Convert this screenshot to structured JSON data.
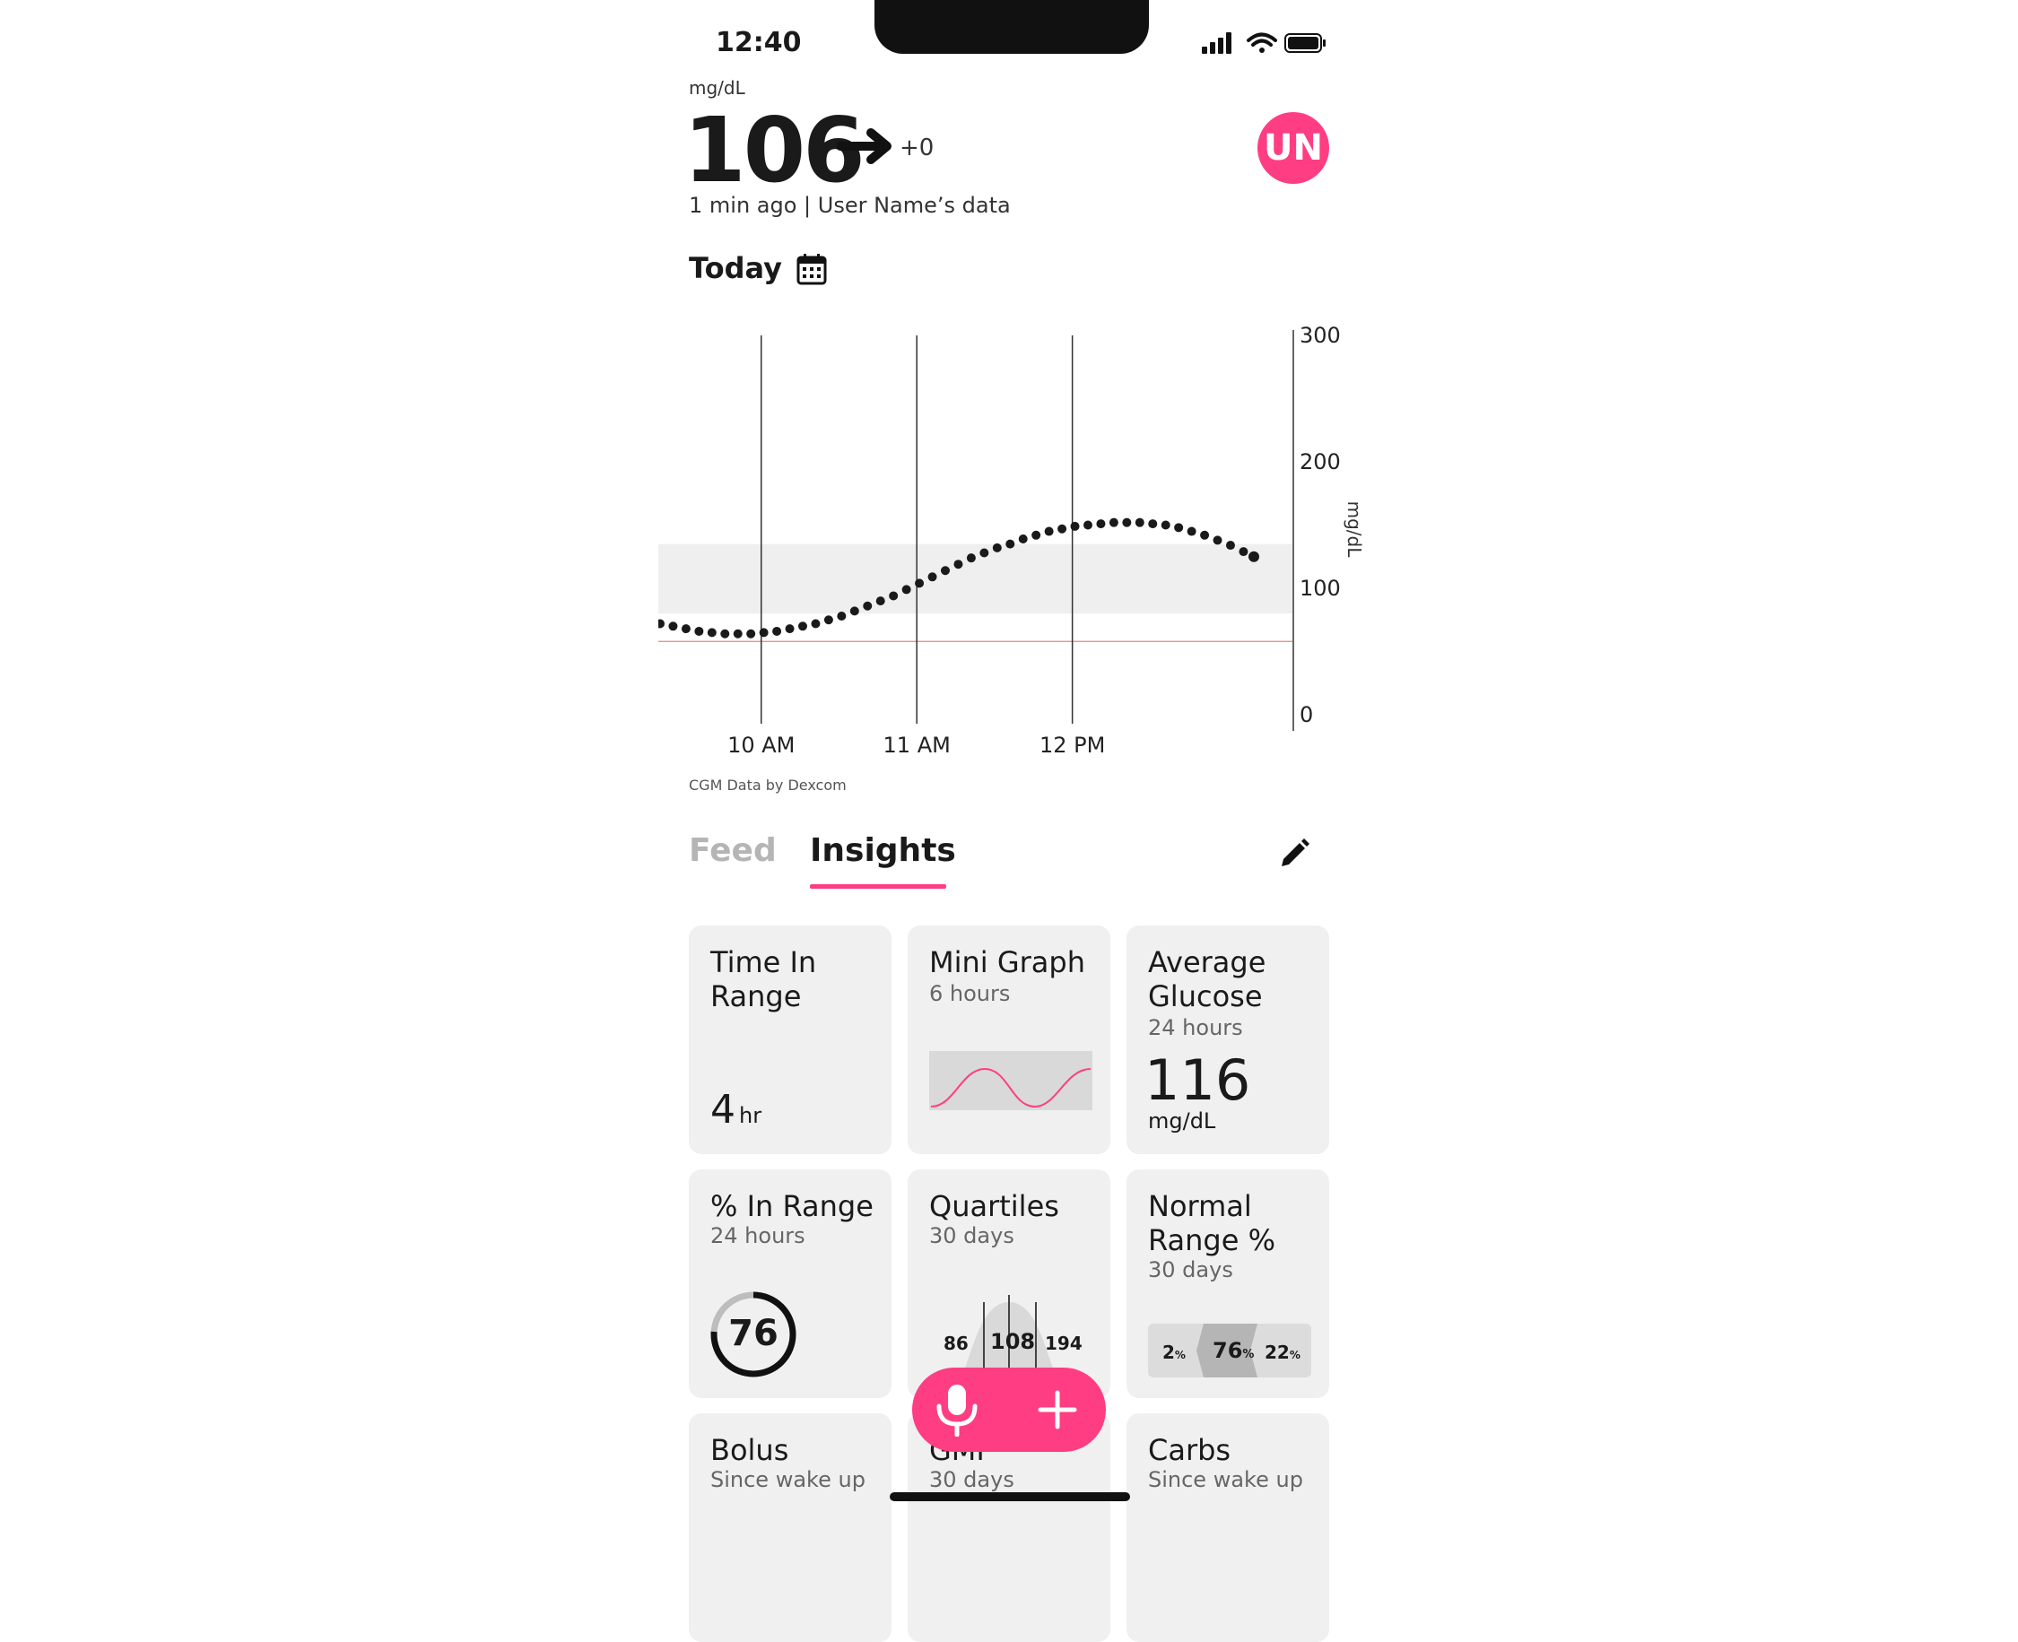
{
  "status_bar": {
    "time": "12:40"
  },
  "reading": {
    "unit": "mg/dL",
    "value": "106",
    "delta": "+0",
    "meta": "1 min ago | User Name’s data"
  },
  "avatar": {
    "initials": "UN",
    "color": "#ff3d82"
  },
  "date_selector": {
    "label": "Today"
  },
  "chart_data": {
    "type": "scatter",
    "x_ticks": [
      "10 AM",
      "11 AM",
      "12 PM"
    ],
    "y_ticks": [
      "300",
      "200",
      "100",
      "0"
    ],
    "ylabel": "mg/dL",
    "ylim": [
      0,
      300
    ],
    "target_range": [
      80,
      135
    ],
    "low_line": 58,
    "x_unit": "minutes from 9:00 AM",
    "xlim": [
      21,
      250
    ],
    "series": [
      {
        "color": "#1a1a1a",
        "points": [
          [
            21,
            72
          ],
          [
            26,
            70
          ],
          [
            31,
            68
          ],
          [
            36,
            66
          ],
          [
            41,
            65
          ],
          [
            46,
            64
          ],
          [
            51,
            64
          ],
          [
            56,
            64
          ],
          [
            61,
            65
          ],
          [
            66,
            66
          ],
          [
            71,
            68
          ],
          [
            76,
            70
          ],
          [
            81,
            72
          ],
          [
            86,
            75
          ],
          [
            91,
            78
          ],
          [
            96,
            82
          ],
          [
            101,
            86
          ],
          [
            106,
            90
          ],
          [
            111,
            94
          ],
          [
            116,
            99
          ],
          [
            121,
            104
          ],
          [
            126,
            109
          ],
          [
            131,
            114
          ],
          [
            136,
            119
          ],
          [
            141,
            124
          ],
          [
            146,
            128
          ],
          [
            151,
            132
          ],
          [
            156,
            135
          ],
          [
            161,
            139
          ],
          [
            166,
            142
          ],
          [
            171,
            145
          ],
          [
            176,
            147
          ],
          [
            181,
            149
          ],
          [
            186,
            150
          ],
          [
            191,
            151
          ],
          [
            196,
            152
          ],
          [
            201,
            152
          ],
          [
            206,
            152
          ],
          [
            211,
            151
          ],
          [
            216,
            150
          ],
          [
            221,
            148
          ],
          [
            226,
            145
          ],
          [
            231,
            142
          ],
          [
            236,
            138
          ],
          [
            241,
            134
          ],
          [
            246,
            129
          ],
          [
            250,
            125
          ]
        ]
      }
    ]
  },
  "chart_source": "CGM Data by Dexcom",
  "tabs": {
    "feed": "Feed",
    "insights": "Insights"
  },
  "cards": {
    "time_in_range": {
      "title_l1": "Time In",
      "title_l2": "Range",
      "value": "4",
      "unit": "hr"
    },
    "mini_graph": {
      "title": "Mini Graph",
      "subtitle": "6 hours"
    },
    "avg_glucose": {
      "title_l1": "Average",
      "title_l2": "Glucose",
      "subtitle": "24 hours",
      "value": "116",
      "unit": "mg/dL"
    },
    "pct_in_range": {
      "title": "% In Range",
      "subtitle": "24 hours",
      "value": "76",
      "fraction": 0.76
    },
    "quartiles": {
      "title": "Quartiles",
      "subtitle": "30 days",
      "q1": "86",
      "median": "108",
      "q3": "194"
    },
    "normal_range": {
      "title_l1": "Normal",
      "title_l2": "Range %",
      "subtitle": "30 days",
      "low": "2",
      "mid": "76",
      "high": "22",
      "pct": "%"
    },
    "bolus": {
      "title": "Bolus",
      "subtitle": "Since wake up"
    },
    "gmi": {
      "title": "GMI",
      "subtitle": "30 days"
    },
    "carbs": {
      "title": "Carbs",
      "subtitle": "Since wake up"
    }
  },
  "icons": {
    "trend": "arrow-right-icon",
    "calendar": "calendar-icon",
    "edit": "pencil-icon",
    "mic": "microphone-icon",
    "add": "plus-icon"
  },
  "colors": {
    "accent": "#ff3d82",
    "card": "#f0f0f0",
    "range_band": "#efefef"
  }
}
